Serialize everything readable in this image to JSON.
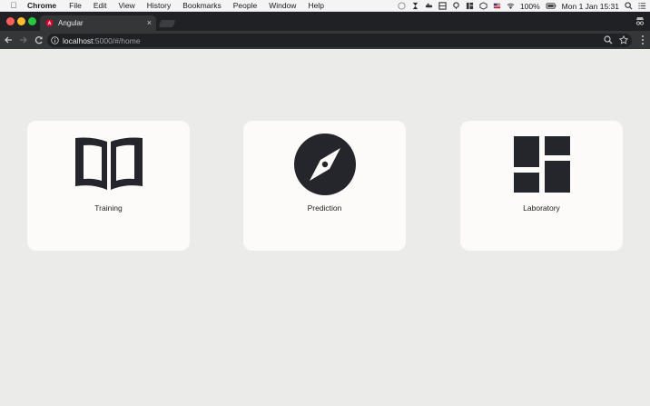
{
  "menubar": {
    "app_name": "Chrome",
    "items": [
      "File",
      "Edit",
      "View",
      "History",
      "Bookmarks",
      "People",
      "Window",
      "Help"
    ],
    "battery": "100%",
    "clock": "Mon 1 Jan  15:31"
  },
  "browser": {
    "tab_title": "Angular",
    "tab_close": "×",
    "url_host": "localhost",
    "url_path": ":5000/#/home"
  },
  "cards": [
    {
      "label": "Training",
      "icon": "open-book-icon"
    },
    {
      "label": "Prediction",
      "icon": "compass-icon"
    },
    {
      "label": "Laboratory",
      "icon": "dashboard-grid-icon"
    }
  ],
  "colors": {
    "page_bg": "#ebebea",
    "card_bg": "#fdfafa",
    "icon": "#24262b",
    "tab_strip": "#202124",
    "toolbar": "#353638",
    "angular_red": "#dd0031"
  }
}
